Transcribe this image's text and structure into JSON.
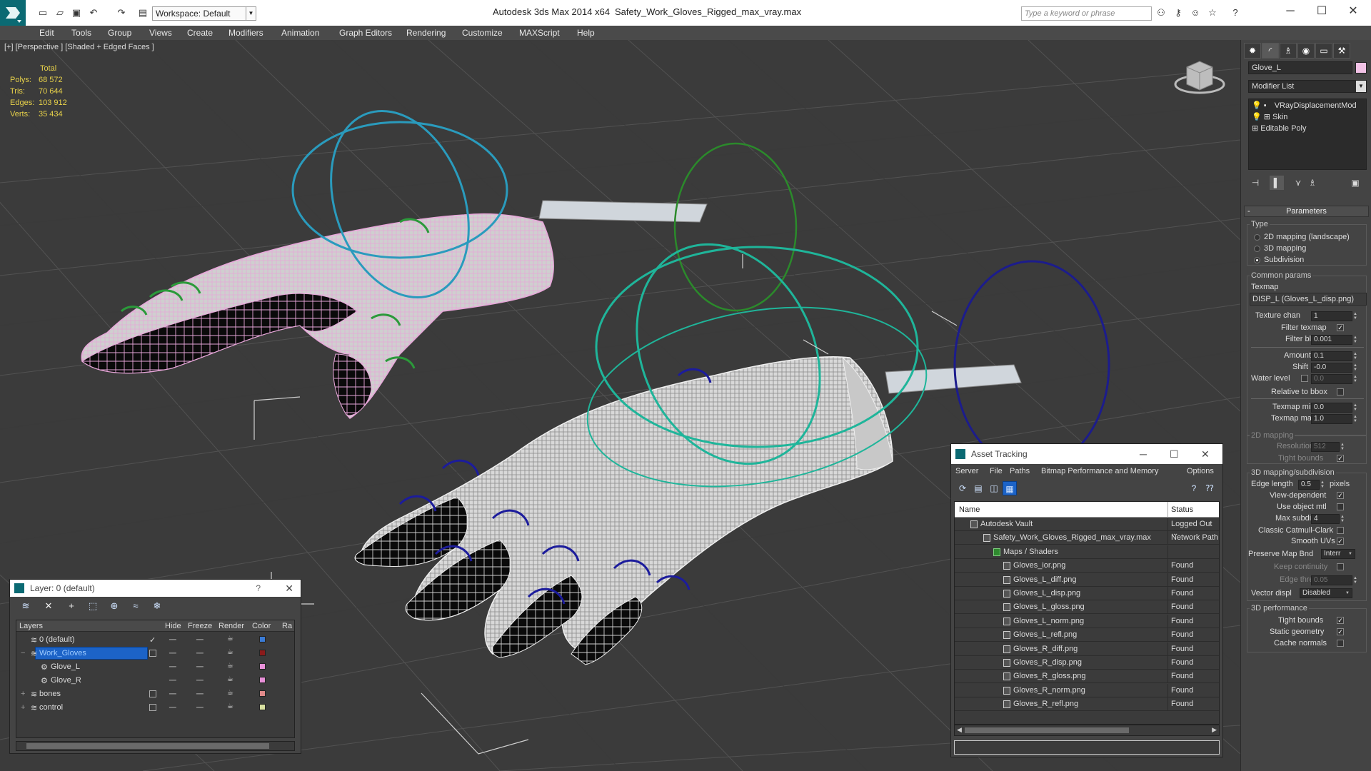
{
  "titlebar": {
    "workspace": "Workspace: Default",
    "app_title": "Autodesk 3ds Max  2014 x64",
    "file_title": "Safety_Work_Gloves_Rigged_max_vray.max",
    "search_placeholder": "Type a keyword or phrase"
  },
  "menu": [
    "Edit",
    "Tools",
    "Group",
    "Views",
    "Create",
    "Modifiers",
    "Animation",
    "Graph Editors",
    "Rendering",
    "Customize",
    "MAXScript",
    "Help"
  ],
  "viewport": {
    "label": "[+] [Perspective ] [Shaded + Edged Faces ]",
    "stats_header": "Total",
    "stats": [
      {
        "k": "Polys:",
        "v": "68 572"
      },
      {
        "k": "Tris:",
        "v": "70 644"
      },
      {
        "k": "Edges:",
        "v": "103 912"
      },
      {
        "k": "Verts:",
        "v": "35 434"
      }
    ]
  },
  "command_panel": {
    "object_name": "Glove_L",
    "object_color": "#f2c2e6",
    "modifier_list": "Modifier List",
    "stack": [
      "VRayDisplacementMod",
      "Skin",
      "Editable Poly"
    ],
    "rollout_title": "Parameters",
    "type_label": "Type",
    "type_options": [
      "2D mapping (landscape)",
      "3D mapping",
      "Subdivision"
    ],
    "type_selected": 2,
    "common_params": "Common params",
    "texmap_label": "Texmap",
    "texmap_value": "DISP_L (Gloves_L_disp.png)",
    "texture_chan_label": "Texture chan",
    "texture_chan": "1",
    "filter_texmap_label": "Filter texmap",
    "filter_blur_label": "Filter blur",
    "filter_blur": "0.001",
    "amount_label": "Amount",
    "amount": "0.1",
    "shift_label": "Shift",
    "shift": "-0.0",
    "water_level_label": "Water level",
    "water_level": "0.0",
    "relative_bbox_label": "Relative to bbox",
    "texmap_min_label": "Texmap min",
    "texmap_min": "0.0",
    "texmap_max_label": "Texmap max",
    "texmap_max": "1.0",
    "mapping_2d": "2D mapping",
    "resolution_label": "Resolution",
    "resolution": "512",
    "tight_bounds_label": "Tight bounds",
    "mapping_3d": "3D mapping/subdivision",
    "edge_length_label": "Edge length",
    "edge_length": "0.5",
    "pixels_label": "pixels",
    "view_dependent_label": "View-dependent",
    "use_object_mtl_label": "Use object mtl",
    "max_subdivs_label": "Max subdivs",
    "max_subdivs": "4",
    "catmull_label": "Classic Catmull-Clark",
    "smooth_uvs_label": "Smooth UVs",
    "preserve_map_label": "Preserve Map Bnd",
    "preserve_map": "Interr",
    "keep_continuity_label": "Keep continuity",
    "edge_thresh_label": "Edge thresh",
    "edge_thresh": "0.05",
    "vector_displ_label": "Vector displ",
    "vector_displ": "Disabled",
    "perf_3d": "3D performance",
    "perf_tight_bounds": "Tight bounds",
    "static_geometry_label": "Static geometry",
    "cache_normals_label": "Cache normals"
  },
  "layer_dialog": {
    "title": "Layer: 0 (default)",
    "help": "?",
    "columns": [
      "Layers",
      "Hide",
      "Freeze",
      "Render",
      "Color",
      "Ra"
    ],
    "rows": [
      {
        "name": "0 (default)",
        "indent": 0,
        "color": "#3a7bd5",
        "current": true
      },
      {
        "name": "Work_Gloves",
        "indent": 0,
        "color": "#8b1a1a",
        "selected": true
      },
      {
        "name": "Glove_L",
        "indent": 1,
        "color": "#e890d8"
      },
      {
        "name": "Glove_R",
        "indent": 1,
        "color": "#e890d8"
      },
      {
        "name": "bones",
        "indent": 0,
        "color": "#e08a8a"
      },
      {
        "name": "control",
        "indent": 0,
        "color": "#d8e0a0"
      }
    ]
  },
  "asset_tracking": {
    "title": "Asset Tracking",
    "menu": [
      "Server",
      "File",
      "Paths",
      "Bitmap Performance and Memory",
      "Options"
    ],
    "columns": [
      "Name",
      "Status"
    ],
    "rows": [
      {
        "name": "Autodesk Vault",
        "status": "Logged Out ...",
        "indent": 1
      },
      {
        "name": "Safety_Work_Gloves_Rigged_max_vray.max",
        "status": "Network Path",
        "indent": 2
      },
      {
        "name": "Maps / Shaders",
        "status": "",
        "indent": 3
      },
      {
        "name": "Gloves_ior.png",
        "status": "Found",
        "indent": 4
      },
      {
        "name": "Gloves_L_diff.png",
        "status": "Found",
        "indent": 4
      },
      {
        "name": "Gloves_L_disp.png",
        "status": "Found",
        "indent": 4
      },
      {
        "name": "Gloves_L_gloss.png",
        "status": "Found",
        "indent": 4
      },
      {
        "name": "Gloves_L_norm.png",
        "status": "Found",
        "indent": 4
      },
      {
        "name": "Gloves_L_refl.png",
        "status": "Found",
        "indent": 4
      },
      {
        "name": "Gloves_R_diff.png",
        "status": "Found",
        "indent": 4
      },
      {
        "name": "Gloves_R_disp.png",
        "status": "Found",
        "indent": 4
      },
      {
        "name": "Gloves_R_gloss.png",
        "status": "Found",
        "indent": 4
      },
      {
        "name": "Gloves_R_norm.png",
        "status": "Found",
        "indent": 4
      },
      {
        "name": "Gloves_R_refl.png",
        "status": "Found",
        "indent": 4
      }
    ]
  }
}
